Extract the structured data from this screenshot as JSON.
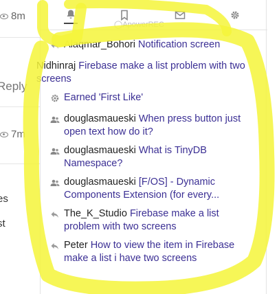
{
  "background": {
    "times": [
      "8m",
      "7m"
    ],
    "reply_label": "Reply",
    "fragments": [
      "es",
      "st"
    ]
  },
  "tabs": [
    {
      "icon": "bell-icon",
      "label": ""
    },
    {
      "icon": "bookmark-icon",
      "label": ""
    },
    {
      "icon": "mail-icon",
      "label": ""
    },
    {
      "icon": "gear-icon",
      "label": ""
    }
  ],
  "watermark": "ApowerREC",
  "notifications": [
    {
      "icon": "reply-icon",
      "user": "Alaqmar_Bohori",
      "topic": "Notification screen"
    },
    {
      "icon": "",
      "user": "Nidhinraj",
      "topic": "Firebase make a list problem with two screens"
    },
    {
      "icon": "badge-icon",
      "user": "",
      "topic": "Earned 'First Like'"
    },
    {
      "icon": "group-icon",
      "user": "douglasmaueski",
      "topic": "When press button just open text how do it?"
    },
    {
      "icon": "group-icon",
      "user": "douglasmaueski",
      "topic": "What is TinyDB Namespace?"
    },
    {
      "icon": "group-icon",
      "user": "douglasmaueski",
      "topic": "[F/OS] - Dynamic Components Extension (for every..."
    },
    {
      "icon": "reply-icon",
      "user": "The_K_Studio",
      "topic": "Firebase make a list problem with two screens"
    },
    {
      "icon": "reply-icon",
      "user": "Peter",
      "topic": "How to view the item in Firebase make a list i have two screens"
    }
  ],
  "colors": {
    "highlight": "#f5f53a",
    "topic_link": "#3b2f94"
  }
}
